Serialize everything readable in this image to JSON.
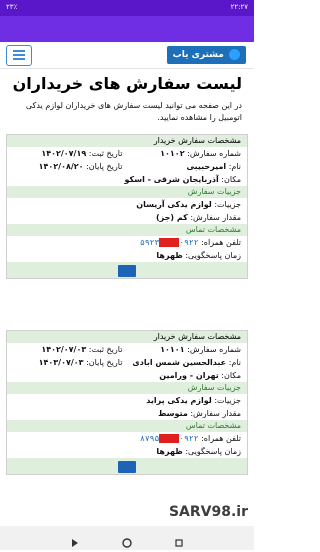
{
  "statusbar": {
    "time": "۲۲:۲۷",
    "left": "۲۳٪"
  },
  "header": {
    "brand": "مشتری یاب",
    "menu_label": "menu"
  },
  "page": {
    "title": "لیست سفارش های خریداران",
    "description": "در این صفحه می توانید لیست سفارش های خریداران لوازم یدکی اتومبیل را مشاهده نمایید."
  },
  "cards": [
    {
      "section_title": "مشخصات سفارش خریدار",
      "order_number_label": "شماره سفارش:",
      "order_number": "۱۰۱۰۲",
      "reg_date_label": "تاریخ ثبت:",
      "reg_date": "۱۴۰۲/۰۷/۱۹",
      "name_label": "نام:",
      "name": "امیرحبیبی",
      "end_date_label": "تاریخ پایان:",
      "end_date": "۱۴۰۲/۰۸/۲۰",
      "location_label": "مکان:",
      "location": "آذربایجان شرقی - اسکو",
      "details_title": "جزییات سفارش",
      "details_label": "جزییات:",
      "details": "لوازم یدکی آریسان",
      "amount_label": "مقدار سفارش:",
      "amount": "کم (جز)",
      "contact_title": "مشخصات تماس",
      "phone_label": "تلفن همراه:",
      "phone_a": "۰۹۲۲",
      "phone_b": "۵۹۲۳",
      "hours_label": "زمان پاسخگویی:",
      "hours": "ظهرها"
    },
    {
      "section_title": "مشخصات سفارش خریدار",
      "order_number_label": "شماره سفارش:",
      "order_number": "۱۰۱۰۱",
      "reg_date_label": "تاریخ ثبت:",
      "reg_date": "۱۴۰۲/۰۷/۰۳",
      "name_label": "نام:",
      "name": "عبدالحسین شمس ابادی",
      "end_date_label": "تاریخ پایان:",
      "end_date": "۱۴۰۳/۰۷/۰۳",
      "location_label": "مکان:",
      "location": "تهران - ورامین",
      "details_title": "جزییات سفارش",
      "details_label": "جزییات:",
      "details": "لوازم یدکی پراید",
      "amount_label": "مقدار سفارش:",
      "amount": "متوسط",
      "contact_title": "مشخصات تماس",
      "phone_label": "تلفن همراه:",
      "phone_a": "۰۹۲۲",
      "phone_b": "۸۷۹۵",
      "hours_label": "زمان پاسخگویی:",
      "hours": "ظهرها"
    }
  ],
  "watermark": "SARV98.ir",
  "colors": {
    "statusbar": "#5a17c9",
    "appbar": "#6f2ee3",
    "brand": "#1c6fb8",
    "section_bg": "#dfeedd",
    "redaction": "#e0201f"
  }
}
